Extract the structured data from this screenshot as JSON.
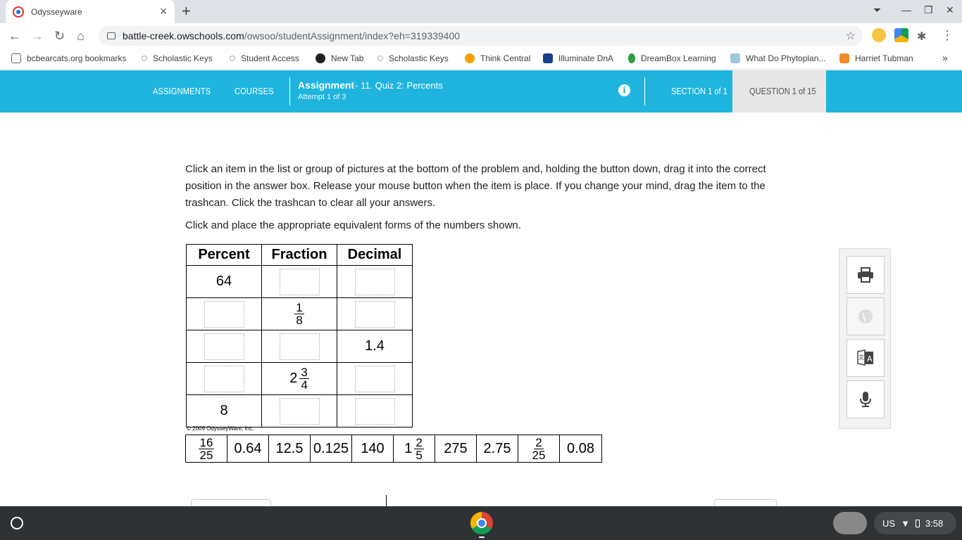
{
  "browser": {
    "tab_title": "Odysseyware",
    "tab_close": "✕",
    "new_tab": "+",
    "url_host": "battle-creek.owschools.com",
    "url_path": "/owsoo/studentAssignment/index?eh=319339400",
    "bookmarks": [
      {
        "label": "bcbearcats.org bookmarks",
        "icon": "folder-icon",
        "color": "#5f6368"
      },
      {
        "label": "Scholastic Keys",
        "icon": "scholastic-icon",
        "color": "#b0b0b0"
      },
      {
        "label": "Student Access",
        "icon": "scholastic-icon",
        "color": "#b0b0b0"
      },
      {
        "label": "New Tab",
        "icon": "globe-icon",
        "color": "#202124"
      },
      {
        "label": "Scholastic Keys",
        "icon": "scholastic-icon",
        "color": "#b0b0b0"
      },
      {
        "label": "Think Central",
        "icon": "think-central-icon",
        "color": "#f4a300"
      },
      {
        "label": "Illuminate DnA",
        "icon": "illuminate-icon",
        "color": "#1a3e8c"
      },
      {
        "label": "DreamBox Learning",
        "icon": "dreambox-icon",
        "color": "#2e9e3e"
      },
      {
        "label": "What Do Phytoplan...",
        "icon": "phytoplankton-icon",
        "color": "#9ec7e0"
      },
      {
        "label": "Harriet Tubman",
        "icon": "harriet-icon",
        "color": "#f28c28"
      }
    ],
    "bookmarks_more": "»"
  },
  "header": {
    "nav_assignments": "ASSIGNMENTS",
    "nav_courses": "COURSES",
    "assignment_label": "Assignment",
    "assignment_name": "- 11. Quiz 2: Percents",
    "attempt": "Attempt 1 of 3",
    "info": "i",
    "section": "SECTION 1 of 1",
    "question": "QUESTION 1 of 15",
    "accent_color": "#1eb4de"
  },
  "content": {
    "instructions": "Click an item in the list or group of pictures at the bottom of the problem and, holding the button down, drag it into the correct position in the answer box. Release your mouse button when the item is place. If you change your mind, drag the item to the trashcan. Click the trashcan to clear all your answers.",
    "prompt": "Click and place the appropriate equivalent forms of the numbers shown.",
    "table_headers": [
      "Percent",
      "Fraction",
      "Decimal"
    ],
    "rows": [
      {
        "percent": "64",
        "fraction_whole": "",
        "fraction_num": "",
        "fraction_den": "",
        "decimal": ""
      },
      {
        "percent": "",
        "fraction_whole": "",
        "fraction_num": "1",
        "fraction_den": "8",
        "decimal": ""
      },
      {
        "percent": "",
        "fraction_whole": "",
        "fraction_num": "",
        "fraction_den": "",
        "decimal": "1.4"
      },
      {
        "percent": "",
        "fraction_whole": "2",
        "fraction_num": "3",
        "fraction_den": "4",
        "decimal": ""
      },
      {
        "percent": "8",
        "fraction_whole": "",
        "fraction_num": "",
        "fraction_den": "",
        "decimal": ""
      }
    ],
    "copyright": "© 2009 OdysseyWare, Inc.",
    "bank": [
      {
        "whole": "",
        "num": "16",
        "den": "25",
        "text": ""
      },
      {
        "text": "0.64"
      },
      {
        "text": "12.5"
      },
      {
        "text": "0.125"
      },
      {
        "text": "140"
      },
      {
        "whole": "1",
        "num": "2",
        "den": "5",
        "text": ""
      },
      {
        "text": "275"
      },
      {
        "text": "2.75"
      },
      {
        "whole": "",
        "num": "2",
        "den": "25",
        "text": ""
      },
      {
        "text": "0.08"
      }
    ]
  },
  "tools": [
    "print-icon",
    "globe-icon",
    "translate-icon",
    "microphone-icon"
  ],
  "shelf": {
    "locale": "US",
    "time": "3:58"
  }
}
